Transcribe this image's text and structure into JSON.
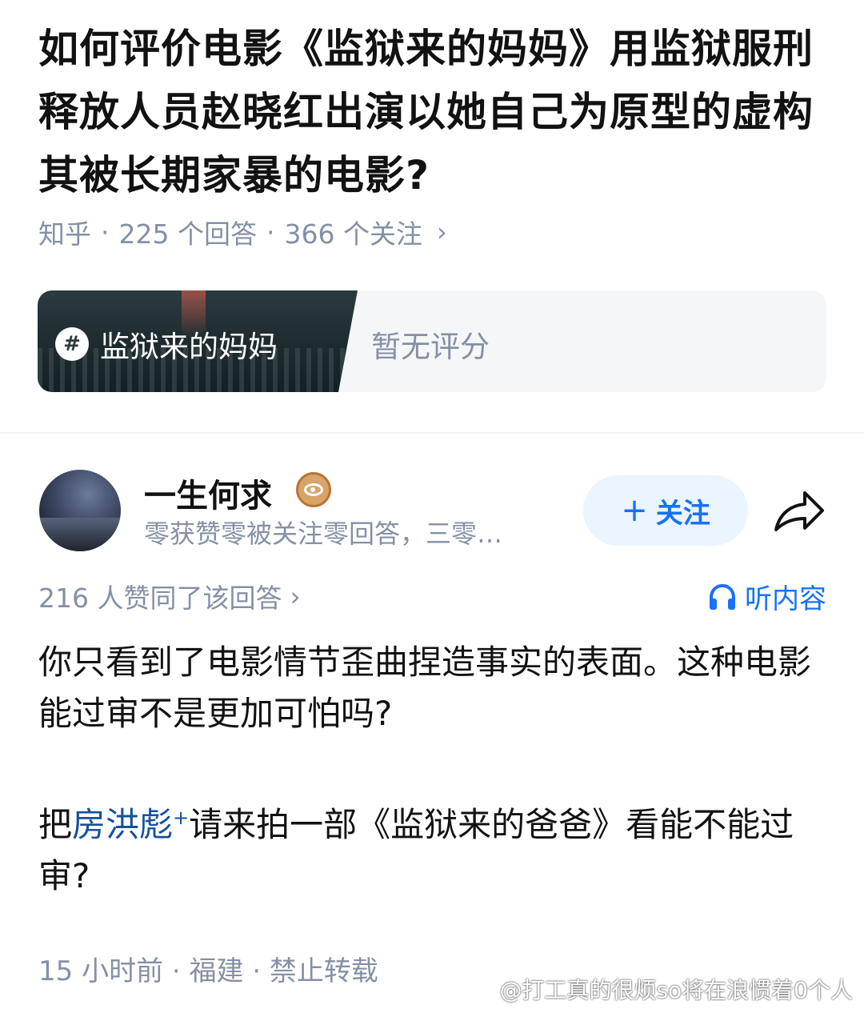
{
  "question": {
    "title": "如何评价电影《监狱来的妈妈》用监狱服刑释放人员赵晓红出演以她自己为原型的虚构其被长期家暴的电影?",
    "source": "知乎",
    "answers": "225 个回答",
    "followers": "366 个关注",
    "separator": "·",
    "chevron": "›"
  },
  "movie_card": {
    "hash": "#",
    "name": "监狱来的妈妈",
    "rating": "暂无评分"
  },
  "answer": {
    "author": {
      "name": "一生何求",
      "bio": "零获赞零被关注零回答，三零…",
      "badge_icon": "eye-badge-icon"
    },
    "follow_label": "关注",
    "follow_plus": "+",
    "share_icon": "share-icon",
    "votes": "216 人赞同了该回答",
    "votes_chevron": "›",
    "listen_label": "听内容",
    "paragraph1": "你只看到了电影情节歪曲捏造事实的表面。这种电影能过审不是更加可怕吗?",
    "paragraph2_before": "把",
    "paragraph2_link": "房洪彪",
    "paragraph2_link_mark": "+",
    "paragraph2_after": "请来拍一部《监狱来的爸爸》看能不能过审?",
    "meta": "15 小时前 · 福建 · 禁止转载"
  },
  "watermark": "@打工真的很烦so将在浪惯着0个人",
  "colors": {
    "link": "#175199",
    "accent": "#1772f6",
    "muted": "#8590a6"
  }
}
